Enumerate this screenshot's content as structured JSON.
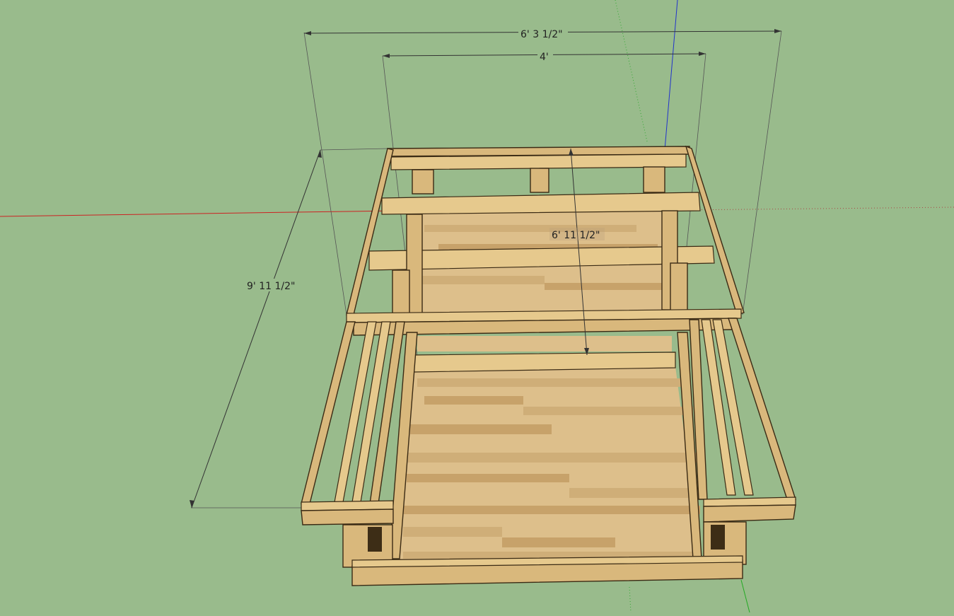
{
  "scene": {
    "background": "#99bb8c",
    "wood_color": "#d9b87c",
    "outline_color": "#3a2a14"
  },
  "dimensions": {
    "overall_width": "6' 3 1/2\"",
    "inner_width": "4'",
    "inner_length": "6' 11 1/2\"",
    "overall_length": "9' 11 1/2\""
  },
  "axes": {
    "x_axis_color": "#cc2222",
    "y_axis_color": "#22aa22",
    "z_axis_color": "#2233cc"
  }
}
